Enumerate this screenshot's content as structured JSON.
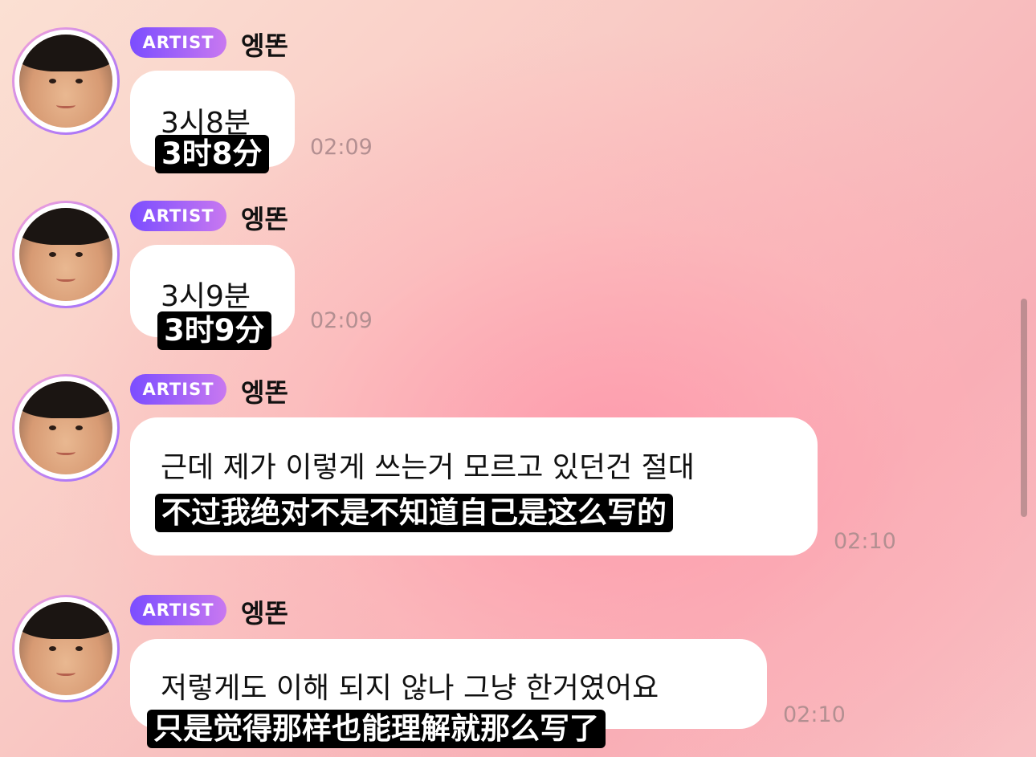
{
  "messages": [
    {
      "badge": "ARTIST",
      "sender": "엥똔",
      "text": "3시8분",
      "subtitle": "3时8分",
      "time": "02:09"
    },
    {
      "badge": "ARTIST",
      "sender": "엥똔",
      "text": "3시9분",
      "subtitle": "3时9分",
      "time": "02:09"
    },
    {
      "badge": "ARTIST",
      "sender": "엥똔",
      "text": "근데 제가 이렇게 쓰는거 모르고 있던건 절대",
      "subtitle": "不过我绝对不是不知道自己是这么写的",
      "time": "02:10"
    },
    {
      "badge": "ARTIST",
      "sender": "엥똔",
      "text": "저렇게도 이해 되지 않나 그냥 한거였어요",
      "subtitle": "只是觉得那样也能理解就那么写了",
      "time": "02:10"
    }
  ],
  "colors": {
    "badge_start": "#7b4dff",
    "badge_end": "#c878f0",
    "bubble": "#ffffff",
    "time": "#b38f91"
  },
  "icons": {
    "avatar": "profile-photo"
  }
}
